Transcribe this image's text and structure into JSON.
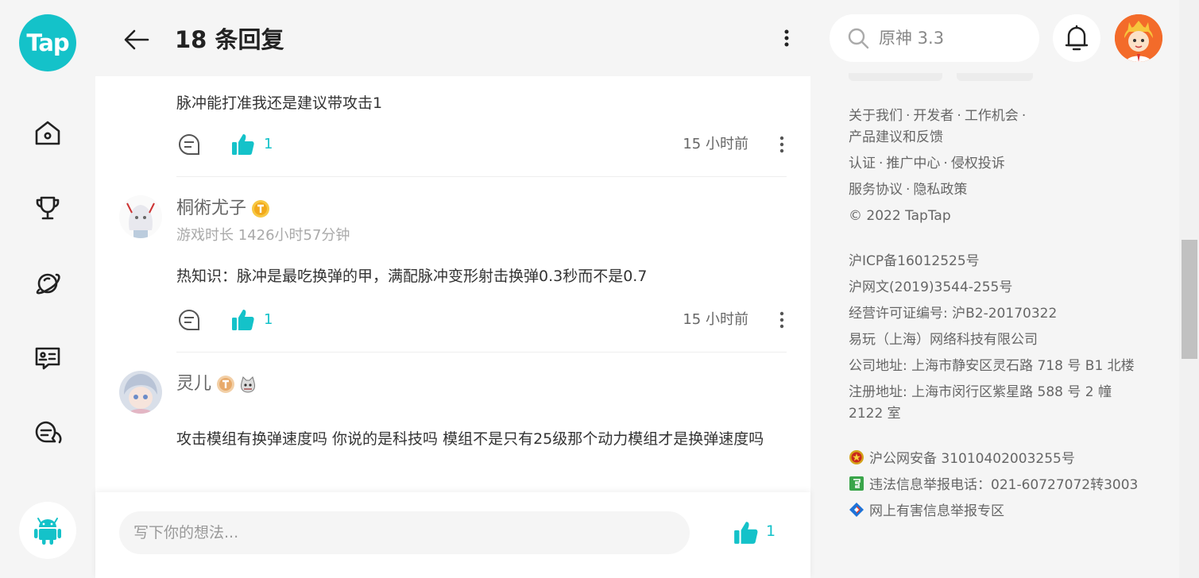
{
  "app": {
    "logo_text": "Tap",
    "brand_color": "#14c2c9"
  },
  "header": {
    "title": "18 条回复"
  },
  "search": {
    "placeholder": "原神 3.3"
  },
  "replies": [
    {
      "content": "脉冲能打准我还是建议带攻击1",
      "likes": "1",
      "time": "15 小时前"
    },
    {
      "username": "桐術尤子",
      "meta": "游戏时长 1426小时57分钟",
      "content": "热知识：脉冲是最吃换弹的甲，满配脉冲变形射击换弹0.3秒而不是0.7",
      "likes": "1",
      "time": "15 小时前"
    },
    {
      "username": "灵儿",
      "content": "攻击模组有换弹速度吗 你说的是科技吗 模组不是只有25级那个动力模组才是换弹速度吗"
    }
  ],
  "reply_bar": {
    "placeholder": "写下你的想法...",
    "likes": "1"
  },
  "footer": {
    "links1": [
      "关于我们",
      "开发者",
      "工作机会"
    ],
    "link_feedback": "产品建议和反馈",
    "links2": [
      "认证",
      "推广中心",
      "侵权投诉"
    ],
    "links3": [
      "服务协议",
      "隐私政策"
    ],
    "copyright": "© 2022 TapTap",
    "icp": "沪ICP备16012525号",
    "netcul": "沪网文(2019)3544-255号",
    "license": "经营许可证编号: 沪B2-20170322",
    "company": "易玩（上海）网络科技有限公司",
    "office_addr": "公司地址: 上海市静安区灵石路 718 号 B1 北楼",
    "reg_addr_1": "注册地址: 上海市闵行区紫星路 588 号 2 幢",
    "reg_addr_2": "2122 室",
    "police": "沪公网安备 31010402003255号",
    "report_phone": "违法信息举报电话：021-60727072转3003",
    "harmful": "网上有害信息举报专区"
  }
}
